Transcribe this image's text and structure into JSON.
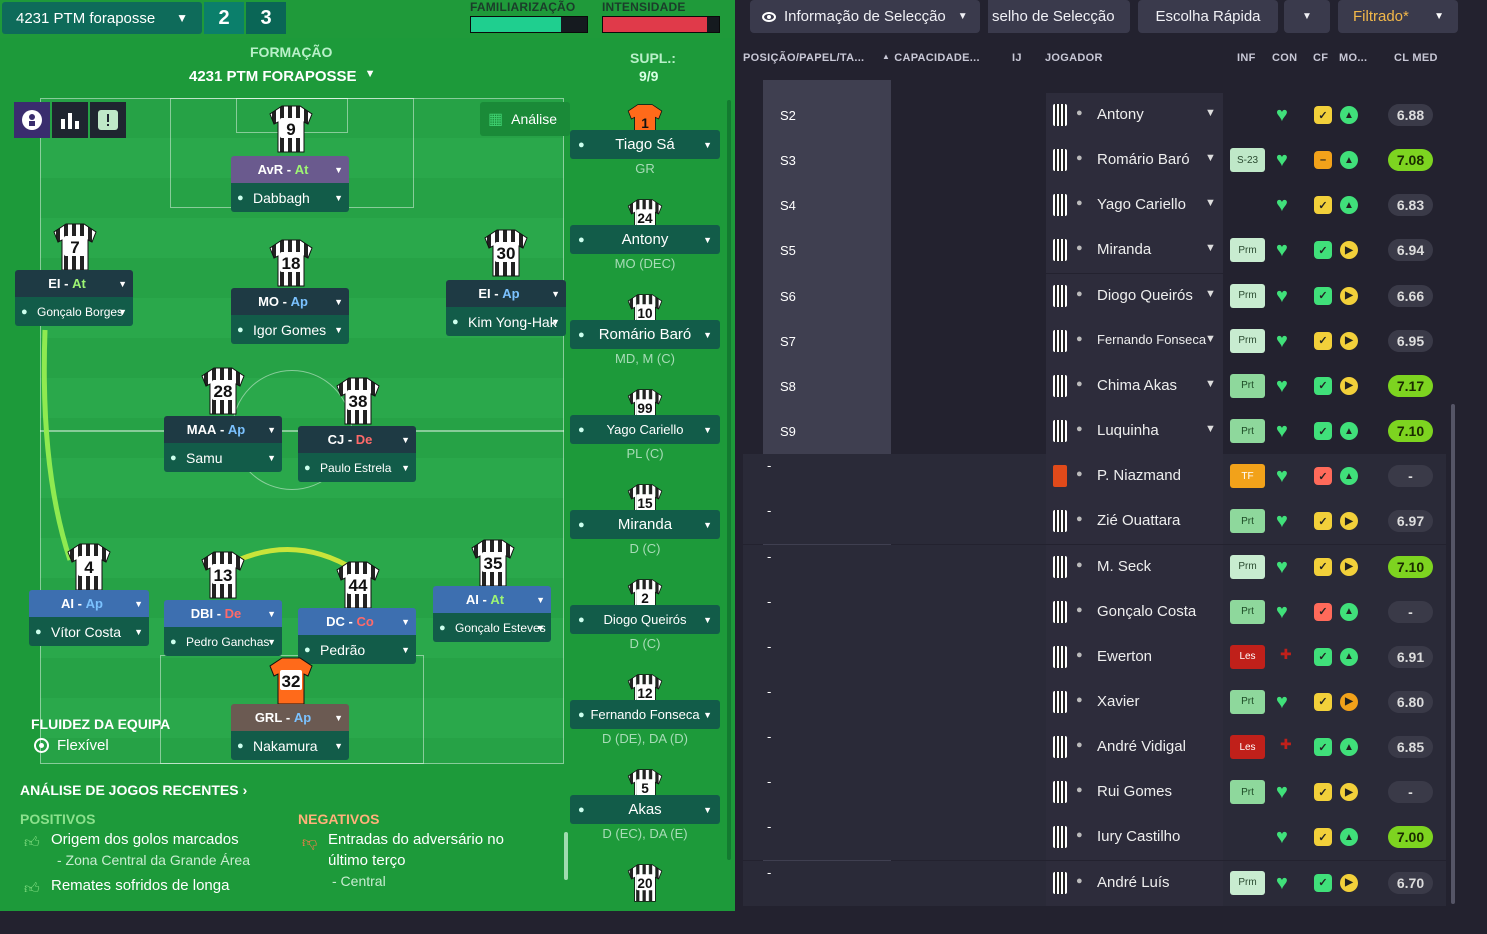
{
  "header": {
    "tactic": "4231 PTM foraposse",
    "num1": "2",
    "num2": "3",
    "fam_label": "FAMILIARIZAÇÃO",
    "int_label": "INTENSIDADE",
    "familiarity": 0.78,
    "intensity": 0.9
  },
  "formation": {
    "label": "FORMAÇÃO",
    "name": "4231 PTM FORAPOSSE",
    "subs_label": "SUPL.:",
    "subs_count": "9/9",
    "analysis_btn": "Análise"
  },
  "players": [
    {
      "num": "9",
      "role": "AvR",
      "duty": "At",
      "dclass": "at",
      "name": "Dabbagh",
      "rolebg": "#6a5a8e"
    },
    {
      "num": "7",
      "role": "EI",
      "duty": "At",
      "dclass": "at",
      "name": "Gonçalo Borges",
      "rolebg": "#1e3a44"
    },
    {
      "num": "18",
      "role": "MO",
      "duty": "Ap",
      "dclass": "ap",
      "name": "Igor Gomes",
      "rolebg": "#1e3a44"
    },
    {
      "num": "30",
      "role": "EI",
      "duty": "Ap",
      "dclass": "ap",
      "name": "Kim Yong-Hak",
      "rolebg": "#1e3a44"
    },
    {
      "num": "28",
      "role": "MAA",
      "duty": "Ap",
      "dclass": "ap",
      "name": "Samu",
      "rolebg": "#1e3a44"
    },
    {
      "num": "38",
      "role": "CJ",
      "duty": "De",
      "dclass": "de",
      "name": "Paulo Estrela",
      "rolebg": "#1e3a44"
    },
    {
      "num": "4",
      "role": "AI",
      "duty": "Ap",
      "dclass": "ap",
      "name": "Vítor Costa",
      "rolebg": "#3d6fb0"
    },
    {
      "num": "13",
      "role": "DBI",
      "duty": "De",
      "dclass": "de",
      "name": "Pedro Ganchas",
      "rolebg": "#3d6fb0"
    },
    {
      "num": "44",
      "role": "DC",
      "duty": "Co",
      "dclass": "co",
      "name": "Pedrão",
      "rolebg": "#3d6fb0"
    },
    {
      "num": "35",
      "role": "AI",
      "duty": "At",
      "dclass": "at",
      "name": "Gonçalo Esteves",
      "rolebg": "#3d6fb0"
    },
    {
      "num": "32",
      "role": "GRL",
      "duty": "Ap",
      "dclass": "ap",
      "name": "Nakamura",
      "rolebg": "#6b5a52"
    }
  ],
  "subs": [
    {
      "num": "1",
      "name": "Tiago Sá",
      "pos": "GR"
    },
    {
      "num": "24",
      "name": "Antony",
      "pos": "MO (DEC)"
    },
    {
      "num": "10",
      "name": "Romário Baró",
      "pos": "MD, M (C)"
    },
    {
      "num": "99",
      "name": "Yago Cariello",
      "pos": "PL (C)"
    },
    {
      "num": "15",
      "name": "Miranda",
      "pos": "D (C)"
    },
    {
      "num": "2",
      "name": "Diogo Queirós",
      "pos": "D (C)"
    },
    {
      "num": "12",
      "name": "Fernando Fonseca",
      "pos": "D (DE), DA (D)"
    },
    {
      "num": "5",
      "name": "Akas",
      "pos": "D (EC), DA (E)"
    },
    {
      "num": "20",
      "name": "",
      "pos": ""
    }
  ],
  "fluidity": {
    "label": "FLUIDEZ DA EQUIPA",
    "value": "Flexível"
  },
  "analysis": {
    "title": "ANÁLISE DE JOGOS RECENTES",
    "pos_label": "POSITIVOS",
    "neg_label": "NEGATIVOS",
    "pos1": "Origem dos golos marcados",
    "pos1b": "- Zona Central da Grande Área",
    "pos2": "Remates sofridos de longa",
    "neg1": "Entradas do adversário no",
    "neg1b": "último terço",
    "neg1c": "- Central"
  },
  "right_header": {
    "info": "Informação de Selecção",
    "advice": "selho de Selecção",
    "quick": "Escolha Rápida",
    "filter": "Filtrado*"
  },
  "columns": {
    "pos": "POSIÇÃO/PAPEL/TA...",
    "cap": "CAPACIDADE...",
    "ij": "IJ",
    "player": "JOGADOR",
    "inf": "INF",
    "con": "CON",
    "cf": "CF",
    "mo": "MO...",
    "cl": "CL MED"
  },
  "rows": [
    {
      "slot": "S2",
      "name": "Antony",
      "inf": "",
      "cf": "y",
      "mo": "g",
      "rating": "6.88",
      "hi": false
    },
    {
      "slot": "S3",
      "name": "Romário Baró",
      "inf": "S-23",
      "cf": "o",
      "mo": "g",
      "rating": "7.08",
      "hi": true
    },
    {
      "slot": "S4",
      "name": "Yago Cariello",
      "inf": "",
      "cf": "y",
      "mo": "g",
      "rating": "6.83",
      "hi": false
    },
    {
      "slot": "S5",
      "name": "Miranda",
      "inf": "Prm",
      "cf": "g",
      "mo": "y",
      "rating": "6.94",
      "hi": false
    },
    {
      "slot": "S6",
      "name": "Diogo Queirós",
      "inf": "Prm",
      "cf": "g",
      "mo": "y",
      "rating": "6.66",
      "hi": false
    },
    {
      "slot": "S7",
      "name": "Fernando Fonseca",
      "inf": "Prm",
      "cf": "y",
      "mo": "y",
      "rating": "6.95",
      "hi": false
    },
    {
      "slot": "S8",
      "name": "Chima Akas",
      "inf": "Prt",
      "cf": "g",
      "mo": "y",
      "rating": "7.17",
      "hi": true
    },
    {
      "slot": "S9",
      "name": "Luquinha",
      "inf": "Prt",
      "cf": "g",
      "mo": "g",
      "rating": "7.10",
      "hi": true
    },
    {
      "slot": "-",
      "name": "P. Niazmand",
      "inf": "TF",
      "cf": "r",
      "mo": "g",
      "rating": "-",
      "hi": false
    },
    {
      "slot": "-",
      "name": "Zié Ouattara",
      "inf": "Prt",
      "cf": "y",
      "mo": "y",
      "rating": "6.97",
      "hi": false
    },
    {
      "slot": "-",
      "name": "M. Seck",
      "inf": "Prm",
      "cf": "y",
      "mo": "y",
      "rating": "7.10",
      "hi": true
    },
    {
      "slot": "-",
      "name": "Gonçalo Costa",
      "inf": "Prt",
      "cf": "r",
      "mo": "g",
      "rating": "-",
      "hi": false
    },
    {
      "slot": "-",
      "name": "Ewerton",
      "inf": "Les",
      "cf": "g",
      "mo": "g",
      "rating": "6.91",
      "hi": false
    },
    {
      "slot": "-",
      "name": "Xavier",
      "inf": "Prt",
      "cf": "y",
      "mo": "o",
      "rating": "6.80",
      "hi": false
    },
    {
      "slot": "-",
      "name": "André Vidigal",
      "inf": "Les",
      "cf": "g",
      "mo": "g",
      "rating": "6.85",
      "hi": false
    },
    {
      "slot": "-",
      "name": "Rui Gomes",
      "inf": "Prt",
      "cf": "y",
      "mo": "y",
      "rating": "-",
      "hi": false
    },
    {
      "slot": "-",
      "name": "Iury Castilho",
      "inf": "",
      "cf": "y",
      "mo": "g",
      "rating": "7.00",
      "hi": true
    },
    {
      "slot": "-",
      "name": "André Luís",
      "inf": "Prm",
      "cf": "g",
      "mo": "y",
      "rating": "6.70",
      "hi": false
    }
  ]
}
